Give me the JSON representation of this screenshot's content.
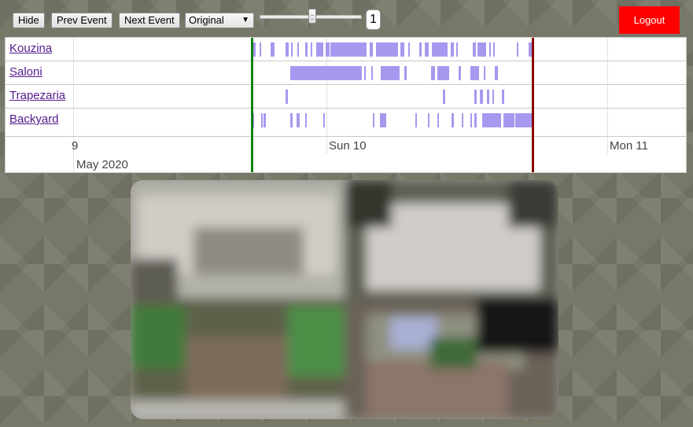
{
  "toolbar": {
    "hide_label": "Hide",
    "prev_label": "Prev Event",
    "next_label": "Next Event",
    "quality_selected": "Original",
    "zoom_value": "1",
    "logout_label": "Logout"
  },
  "timeline": {
    "rows": [
      {
        "label": "Kouzina",
        "events": [
          [
            322,
            3
          ],
          [
            330,
            2
          ],
          [
            344,
            5
          ],
          [
            363,
            4
          ],
          [
            370,
            2
          ],
          [
            378,
            2
          ],
          [
            388,
            3
          ],
          [
            395,
            2
          ],
          [
            402,
            9
          ],
          [
            414,
            5
          ],
          [
            420,
            46
          ],
          [
            470,
            4
          ],
          [
            478,
            28
          ],
          [
            509,
            5
          ],
          [
            519,
            2
          ],
          [
            533,
            3
          ],
          [
            540,
            5
          ],
          [
            549,
            20
          ],
          [
            573,
            4
          ],
          [
            580,
            2
          ],
          [
            601,
            4
          ],
          [
            607,
            11
          ],
          [
            622,
            2
          ],
          [
            627,
            2
          ],
          [
            657,
            2
          ],
          [
            672,
            4
          ]
        ]
      },
      {
        "label": "Saloni",
        "events": [
          [
            369,
            91
          ],
          [
            463,
            2
          ],
          [
            472,
            2
          ],
          [
            484,
            24
          ],
          [
            514,
            3
          ],
          [
            548,
            5
          ],
          [
            556,
            15
          ],
          [
            583,
            3
          ],
          [
            598,
            11
          ],
          [
            615,
            2
          ],
          [
            629,
            4
          ]
        ]
      },
      {
        "label": "Trapezaria",
        "events": [
          [
            363,
            3
          ],
          [
            563,
            3
          ],
          [
            603,
            3
          ],
          [
            610,
            4
          ],
          [
            619,
            3
          ],
          [
            626,
            2
          ],
          [
            638,
            3
          ]
        ]
      },
      {
        "label": "Backyard",
        "events": [
          [
            320,
            3
          ],
          [
            332,
            2
          ],
          [
            335,
            3
          ],
          [
            369,
            3
          ],
          [
            377,
            4
          ],
          [
            388,
            2
          ],
          [
            411,
            2
          ],
          [
            474,
            2
          ],
          [
            483,
            8
          ],
          [
            528,
            2
          ],
          [
            544,
            2
          ],
          [
            556,
            2
          ],
          [
            574,
            3
          ],
          [
            587,
            2
          ],
          [
            598,
            2
          ],
          [
            603,
            3
          ],
          [
            613,
            24
          ],
          [
            640,
            14
          ],
          [
            655,
            21
          ]
        ]
      }
    ],
    "axis": {
      "tick_partial": "9",
      "tick_sun": "Sun 10",
      "tick_mon": "Mon 11",
      "month_label": "May 2020"
    },
    "colors": {
      "event": "#a798ef",
      "start_marker": "#138013",
      "end_marker": "#8a0000",
      "link": "#551a8b"
    }
  },
  "camera_feed": {
    "description_icon": "camera-grid-snapshot"
  }
}
